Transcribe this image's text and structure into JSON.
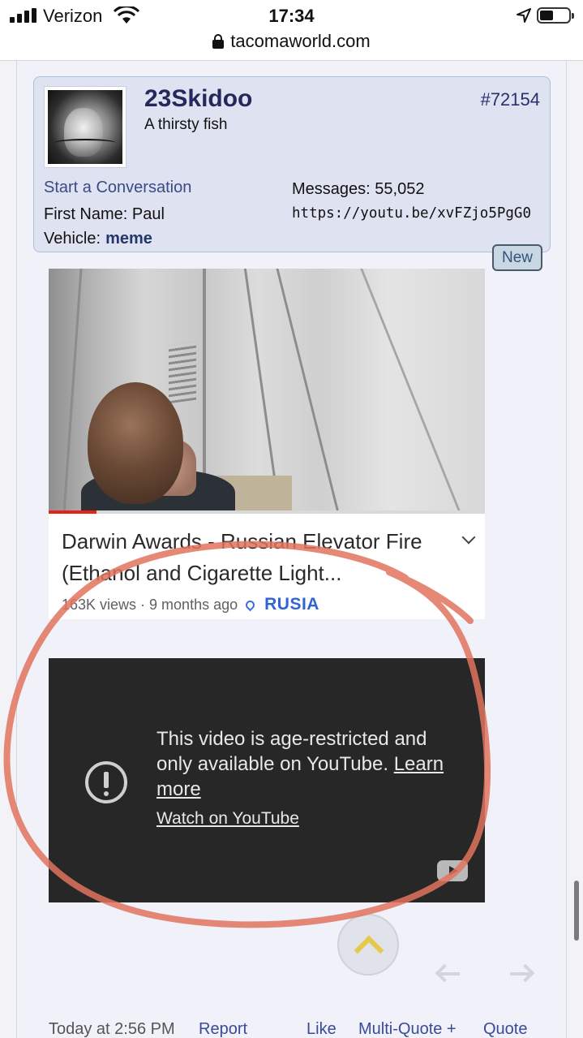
{
  "status_bar": {
    "carrier": "Verizon",
    "time": "17:34"
  },
  "address_bar": {
    "url": "tacomaworld.com"
  },
  "user_card": {
    "username": "23Skidoo",
    "user_title": "A thirsty fish",
    "post_number": "#72154",
    "start_conversation": "Start a Conversation",
    "first_name": "First Name:  Paul",
    "vehicle_label": "Vehicle:",
    "vehicle_value": "meme",
    "messages": "Messages:  55,052",
    "link": "https://youtu.be/xvFZjo5PgG0"
  },
  "new_badge": "New",
  "video1": {
    "title": "Darwin Awards - Russian Elevator Fire (Ethanol and Cigarette Light...",
    "views": "163K views · 9 months ago",
    "location": "RUSIA",
    "progress": 0.11
  },
  "video2": {
    "message": "This video is age-restricted and only available on YouTube.",
    "learn_more": "Learn more",
    "watch": "Watch on YouTube"
  },
  "footer": {
    "date": "Today at 2:56 PM",
    "report": "Report",
    "like": "Like",
    "multi_quote": "Multi-Quote +",
    "quote": "Quote"
  },
  "colors": {
    "annotation": "#e0735e",
    "accent": "#3a4a9a",
    "location": "#2f63d6"
  }
}
